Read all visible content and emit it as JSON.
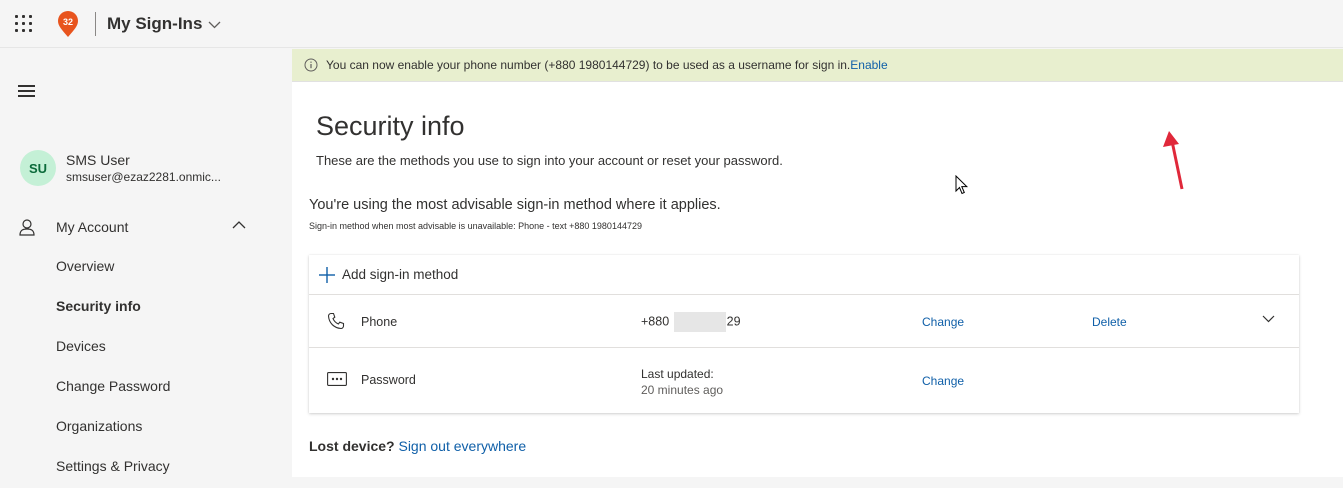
{
  "header": {
    "app_title": "My Sign-Ins",
    "org_badge_count": "32",
    "icons": {
      "waffle": "app-launcher-icon",
      "badge": "org-badge-icon",
      "dropdown": "chevron-down-icon"
    }
  },
  "sidebar": {
    "user": {
      "initials": "SU",
      "name": "SMS User",
      "email": "smsuser@ezaz2281.onmic..."
    },
    "section": {
      "label": "My Account",
      "icon": "person-icon",
      "expanded": true
    },
    "items": [
      {
        "label": "Overview",
        "active": false
      },
      {
        "label": "Security info",
        "active": true
      },
      {
        "label": "Devices",
        "active": false
      },
      {
        "label": "Change Password",
        "active": false
      },
      {
        "label": "Organizations",
        "active": false
      },
      {
        "label": "Settings & Privacy",
        "active": false
      }
    ]
  },
  "banner": {
    "text": "You can now enable your phone number (+880 1980144729) to be used as a username for sign in.",
    "link": "Enable"
  },
  "main": {
    "title": "Security info",
    "description": "These are the methods you use to sign into your account or reset your password.",
    "advisable": "You're using the most advisable sign-in method where it applies.",
    "advisable_sub": "Sign-in method when most advisable is unavailable: Phone - text +880 1980144729",
    "add_method": "Add sign-in method",
    "methods": [
      {
        "name": "Phone",
        "value_prefix": "+880",
        "value_suffix": "29",
        "change": "Change",
        "delete": "Delete",
        "icon": "phone-icon"
      },
      {
        "name": "Password",
        "updated_label": "Last updated:",
        "updated_time": "20 minutes ago",
        "change": "Change",
        "icon": "password-dots-icon"
      }
    ],
    "lost_device": "Lost device?",
    "sign_out": "Sign out everywhere"
  },
  "colors": {
    "accent": "#0f5fa8",
    "banner_bg": "#e8efcf",
    "badge": "#e8541e",
    "avatar_bg": "#c4f0d6",
    "annotation_arrow": "#e0283a"
  }
}
